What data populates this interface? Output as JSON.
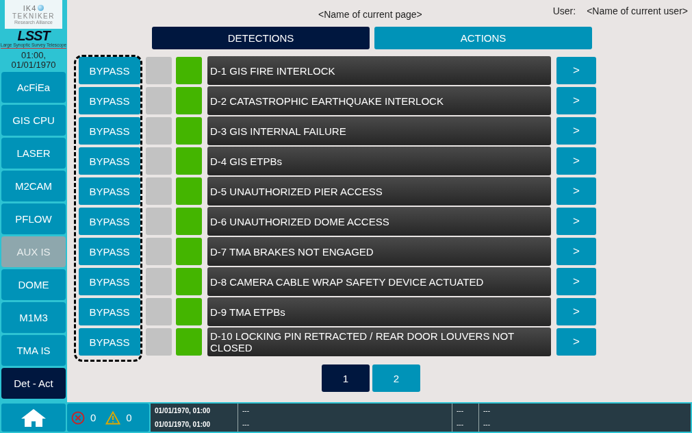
{
  "logo": {
    "name": "IK4",
    "brand": "TEKNIKER",
    "tagline": "Research Alliance"
  },
  "lsst_logo": {
    "name": "LSST",
    "tagline": "Large Synoptic Survey Telescope"
  },
  "clock": "01:00, 01/01/1970",
  "sidebar": {
    "items": [
      {
        "label": "AcFiEa",
        "selected": false,
        "disabled": false
      },
      {
        "label": "GIS CPU",
        "selected": false,
        "disabled": false
      },
      {
        "label": "LASER",
        "selected": false,
        "disabled": false
      },
      {
        "label": "M2CAM",
        "selected": false,
        "disabled": false
      },
      {
        "label": "PFLOW",
        "selected": false,
        "disabled": false
      },
      {
        "label": "AUX IS",
        "selected": false,
        "disabled": true
      },
      {
        "label": "DOME",
        "selected": false,
        "disabled": false
      },
      {
        "label": "M1M3",
        "selected": false,
        "disabled": false
      },
      {
        "label": "TMA IS",
        "selected": false,
        "disabled": false
      },
      {
        "label": "Det - Act",
        "selected": true,
        "disabled": false
      }
    ]
  },
  "page_title": "<Name of current page>",
  "user": {
    "label": "User:",
    "name": "<Name of current user>"
  },
  "tabs": [
    {
      "label": "DETECTIONS",
      "selected": true
    },
    {
      "label": "ACTIONS",
      "selected": false
    }
  ],
  "rows": [
    {
      "bypass": "BYPASS",
      "bypassed": false,
      "ok": true,
      "title": "D-1 GIS FIRE INTERLOCK",
      "arrow": ">"
    },
    {
      "bypass": "BYPASS",
      "bypassed": false,
      "ok": true,
      "title": "D-2 CATASTROPHIC EARTHQUAKE INTERLOCK",
      "arrow": ">"
    },
    {
      "bypass": "BYPASS",
      "bypassed": false,
      "ok": true,
      "title": "D-3 GIS INTERNAL FAILURE",
      "arrow": ">"
    },
    {
      "bypass": "BYPASS",
      "bypassed": false,
      "ok": true,
      "title": "D-4 GIS ETPBs",
      "arrow": ">"
    },
    {
      "bypass": "BYPASS",
      "bypassed": false,
      "ok": true,
      "title": "D-5 UNAUTHORIZED PIER ACCESS",
      "arrow": ">"
    },
    {
      "bypass": "BYPASS",
      "bypassed": false,
      "ok": true,
      "title": "D-6 UNAUTHORIZED DOME ACCESS",
      "arrow": ">"
    },
    {
      "bypass": "BYPASS",
      "bypassed": false,
      "ok": true,
      "title": "D-7 TMA BRAKES NOT ENGAGED",
      "arrow": ">"
    },
    {
      "bypass": "BYPASS",
      "bypassed": false,
      "ok": true,
      "title": "D-8 CAMERA CABLE WRAP SAFETY DEVICE ACTUATED",
      "arrow": ">"
    },
    {
      "bypass": "BYPASS",
      "bypassed": false,
      "ok": true,
      "title": "D-9 TMA ETPBs",
      "arrow": ">"
    },
    {
      "bypass": "BYPASS",
      "bypassed": false,
      "ok": true,
      "title": "D-10 LOCKING PIN RETRACTED / REAR DOOR LOUVERS NOT CLOSED",
      "arrow": ">"
    }
  ],
  "pages": [
    {
      "label": "1",
      "selected": true
    },
    {
      "label": "2",
      "selected": false
    }
  ],
  "status_bar": {
    "errors": "0",
    "warnings": "0",
    "log": [
      {
        "time": "01/01/1970, 01:00",
        "message": "---",
        "code": "---",
        "detail": "---"
      },
      {
        "time": "01/01/1970, 01:00",
        "message": "---",
        "code": "---",
        "detail": "---"
      }
    ]
  }
}
